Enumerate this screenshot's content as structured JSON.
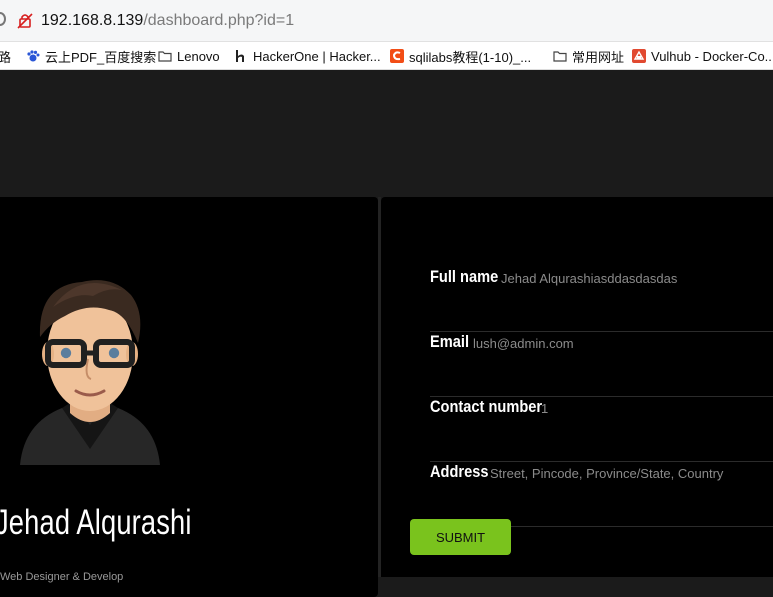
{
  "browser": {
    "url_host": "192.168.8.139",
    "url_path": "/dashboard.php?id=1",
    "bookmarks": [
      {
        "label": "路",
        "icon": "folder-icon"
      },
      {
        "label": "云上PDF_百度搜索",
        "icon": "baidu-paw-icon"
      },
      {
        "label": "Lenovo",
        "icon": "folder-icon"
      },
      {
        "label": "HackerOne | Hacker...",
        "icon": "hackerone-icon"
      },
      {
        "label": "sqlilabs教程(1-10)_...",
        "icon": "csdn-icon"
      },
      {
        "label": "常用网址",
        "icon": "folder-icon"
      },
      {
        "label": "Vulhub - Docker-Co...",
        "icon": "vulhub-icon"
      }
    ]
  },
  "profile": {
    "name": "Jehad Alqurashi",
    "subtitle": "Web Designer & Develop",
    "avatar_icon": "avatar-man-glasses-icon"
  },
  "details": {
    "full_name_label": "Full name",
    "full_name_value": "Jehad Alqurashiasddasdasdas",
    "email_label": "Email",
    "email_value": "lush@admin.com",
    "contact_label": "Contact number",
    "contact_value": "1",
    "address_label": "Address",
    "address_value": "Street, Pincode, Province/State, Country"
  },
  "actions": {
    "submit_label": "SUBMIT"
  },
  "colors": {
    "page_background": "#1b1b1b",
    "card_background": "#000000",
    "submit_button": "#7ac31d",
    "secondary_text": "#8b8b8b"
  }
}
